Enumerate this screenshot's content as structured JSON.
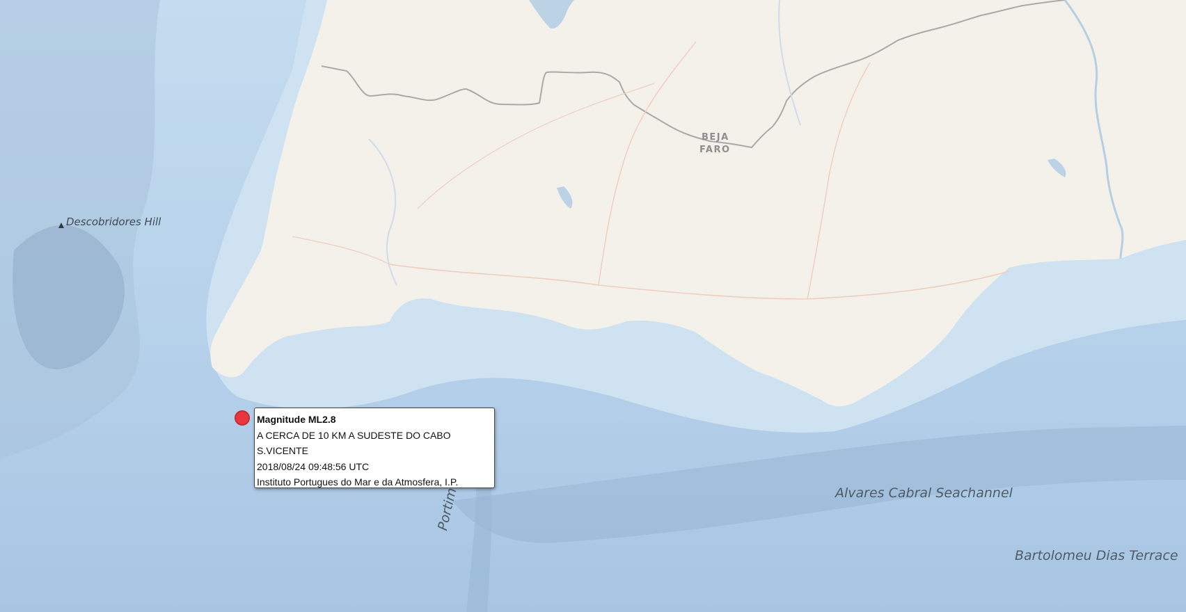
{
  "map": {
    "features": {
      "seamount": "Descobridores Hill",
      "seachannel": "Alvares Cabral Seachannel",
      "terrace": "Bartolomeu Dias Terrace",
      "canyon": "Portimão Canyon"
    },
    "regions": {
      "north": "BEJA",
      "south": "FARO"
    },
    "icons": {
      "seamount": "triangle-marker-icon",
      "event": "earthquake-marker-icon"
    },
    "colors": {
      "ocean": "#b9d3ea",
      "land": "#f3f1ea",
      "marker": "#f0262c"
    }
  },
  "event_popup": {
    "title": "Magnitude ML2.8",
    "location_line1": "A CERCA DE 10 KM A SUDESTE DO CABO",
    "location_line2": "S.VICENTE",
    "datetime": "2018/08/24 09:48:56 UTC",
    "source": "Instituto Portugues do Mar e da Atmosfera, I.P."
  }
}
